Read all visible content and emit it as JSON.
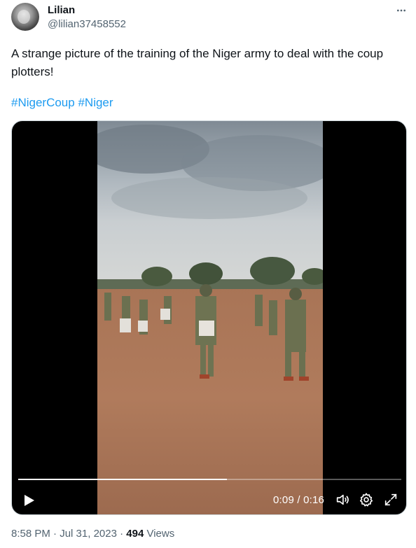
{
  "author": {
    "name": "Lilian",
    "handle": "@lilian37458552",
    "avatar_icon": "profile-photo-avatar"
  },
  "more_icon": "more-horizontal-icon",
  "tweet": {
    "text": "A strange picture of the training of the Niger army to deal with the coup plotters!",
    "hashtags": [
      "#NigerCoup",
      "#Niger"
    ]
  },
  "video": {
    "current_time": "0:09",
    "separator": " / ",
    "duration": "0:16",
    "progress_fraction": 0.545,
    "icons": {
      "play": "play-icon",
      "volume": "volume-icon",
      "settings": "settings-gear-icon",
      "fullscreen": "fullscreen-expand-icon"
    }
  },
  "meta": {
    "time": "8:58 PM",
    "dot1": " · ",
    "date": "Jul 31, 2023",
    "dot2": " · ",
    "views_count": "494",
    "views_label": " Views"
  },
  "colors": {
    "link": "#1d9bf0",
    "secondary_text": "#536471",
    "primary_text": "#0f1419"
  }
}
